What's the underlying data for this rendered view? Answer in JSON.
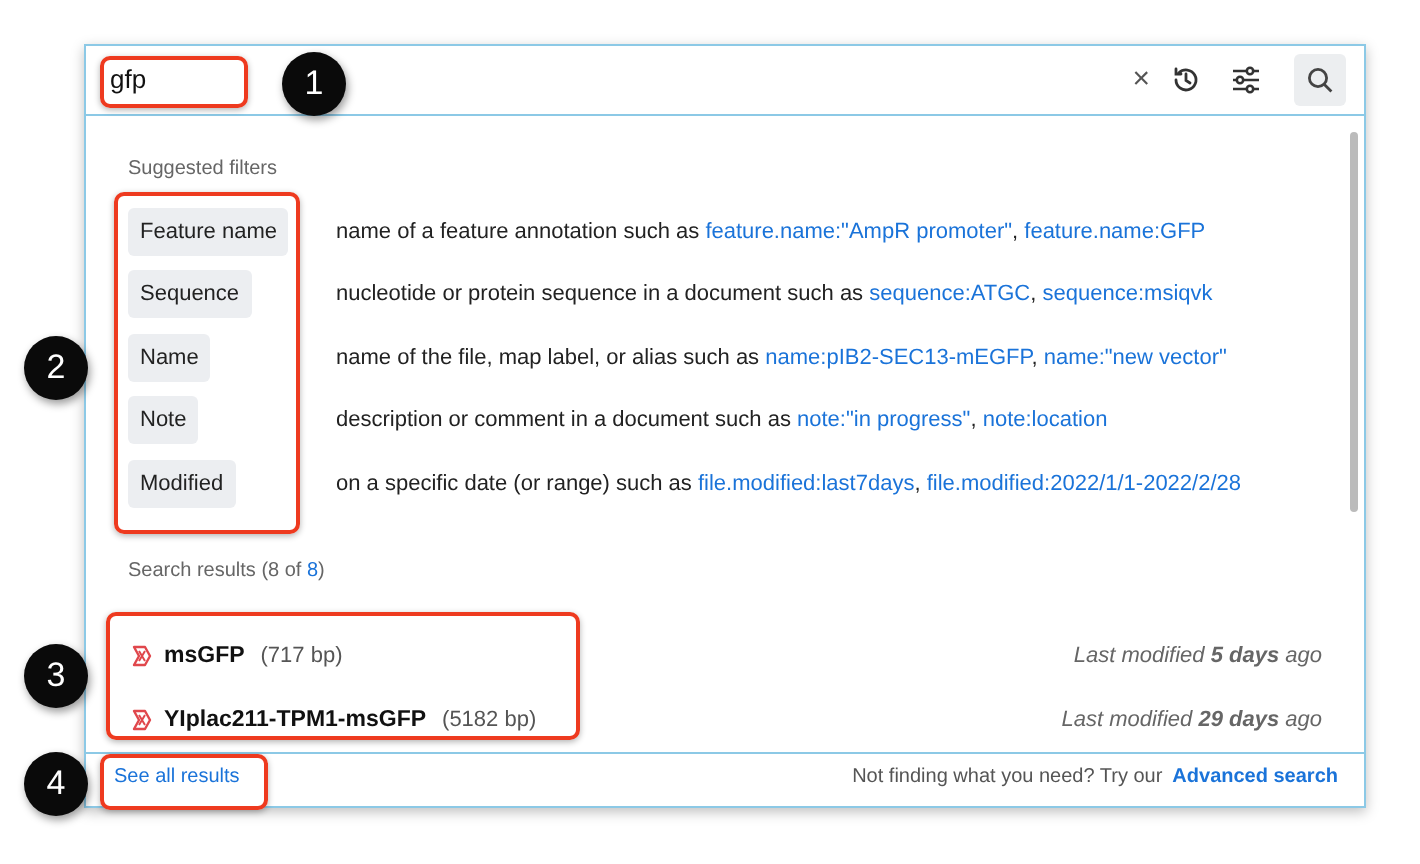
{
  "search": {
    "value": "gfp",
    "clear": "×"
  },
  "filters_heading": "Suggested filters",
  "filters": [
    {
      "chip": "Feature name",
      "parts": [
        {
          "kind": "text",
          "text": "name of a feature annotation such as "
        },
        {
          "kind": "link",
          "text": "feature.name:\"AmpR promoter\""
        },
        {
          "kind": "text",
          "text": ", "
        },
        {
          "kind": "link",
          "text": "feature.name:GFP"
        }
      ]
    },
    {
      "chip": "Sequence",
      "parts": [
        {
          "kind": "text",
          "text": "nucleotide or protein sequence in a document such as "
        },
        {
          "kind": "link",
          "text": "sequence:ATGC"
        },
        {
          "kind": "text",
          "text": ", "
        },
        {
          "kind": "link",
          "text": "sequence:msiqvk"
        }
      ]
    },
    {
      "chip": "Name",
      "parts": [
        {
          "kind": "text",
          "text": "name of the file, map label, or alias such as "
        },
        {
          "kind": "link",
          "text": "name:pIB2-SEC13-mEGFP"
        },
        {
          "kind": "text",
          "text": ", "
        },
        {
          "kind": "link",
          "text": "name:\"new vector\""
        }
      ]
    },
    {
      "chip": "Note",
      "parts": [
        {
          "kind": "text",
          "text": "description or comment in a document such as "
        },
        {
          "kind": "link",
          "text": "note:\"in progress\""
        },
        {
          "kind": "text",
          "text": ", "
        },
        {
          "kind": "link",
          "text": "note:location"
        }
      ]
    },
    {
      "chip": "Modified",
      "parts": [
        {
          "kind": "text",
          "text": "on a specific date (or range) such as "
        },
        {
          "kind": "link",
          "text": "file.modified:last7days"
        },
        {
          "kind": "text",
          "text": ", "
        },
        {
          "kind": "link",
          "text": "file.modified:2022/1/1-2022/2/28"
        }
      ]
    }
  ],
  "results_heading": [
    {
      "kind": "text",
      "text": "Search results (8 of "
    },
    {
      "kind": "link",
      "text": "8"
    },
    {
      "kind": "text",
      "text": ")"
    }
  ],
  "results": [
    {
      "name": "msGFP",
      "size": "(717 bp)",
      "modified": "Last modified **5 days** ago"
    },
    {
      "name": "YIplac211-TPM1-msGFP",
      "size": "(5182 bp)",
      "modified": "Last modified **29 days** ago"
    }
  ],
  "footer": {
    "see_all": "See all results",
    "prompt": "Not finding what you need? Try our",
    "advanced": "Advanced search"
  },
  "callouts": [
    {
      "number": "1"
    },
    {
      "number": "2"
    },
    {
      "number": "3"
    },
    {
      "number": "4"
    }
  ]
}
